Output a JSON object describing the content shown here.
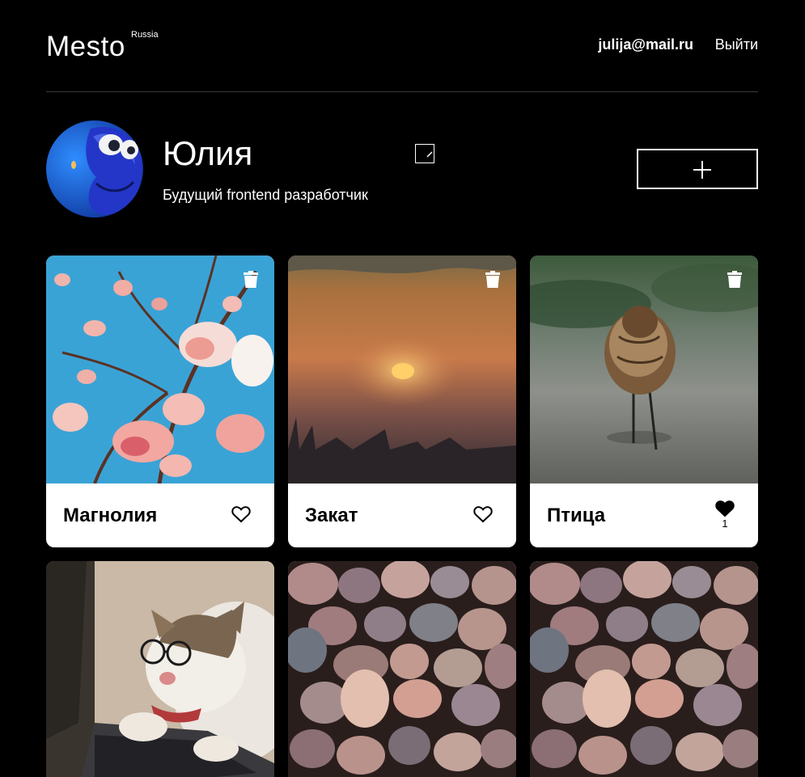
{
  "header": {
    "logo": "Mesto",
    "logo_sub": "Russia",
    "email": "julija@mail.ru",
    "logout": "Выйти"
  },
  "profile": {
    "name": "Юлия",
    "about": "Будущий frontend разработчик",
    "avatar_icon": "cartoon-fish-avatar",
    "edit_icon": "pencil-icon",
    "add_icon": "plus-icon"
  },
  "cards": [
    {
      "title": "Магнолия",
      "liked": false,
      "likes": ""
    },
    {
      "title": "Закат",
      "liked": false,
      "likes": ""
    },
    {
      "title": "Птица",
      "liked": true,
      "likes": "1"
    },
    {
      "title": "",
      "liked": false,
      "likes": ""
    },
    {
      "title": "",
      "liked": false,
      "likes": ""
    },
    {
      "title": "",
      "liked": false,
      "likes": ""
    }
  ],
  "colors": {
    "background": "#000000",
    "card": "#ffffff",
    "text_dark": "#000000",
    "divider": "#545454"
  }
}
